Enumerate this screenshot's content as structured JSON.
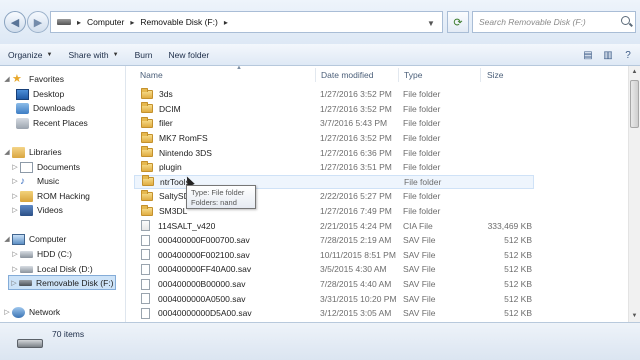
{
  "window": {
    "breadcrumb": [
      "Computer",
      "Removable Disk (F:)"
    ],
    "search_placeholder": "Search Removable Disk (F:)"
  },
  "toolbar": {
    "organize": "Organize",
    "share_with": "Share with",
    "burn": "Burn",
    "new_folder": "New folder"
  },
  "sidebar": {
    "favorites": "Favorites",
    "favorites_items": [
      "Desktop",
      "Downloads",
      "Recent Places"
    ],
    "libraries": "Libraries",
    "libraries_items": [
      "Documents",
      "Music",
      "ROM Hacking",
      "Videos"
    ],
    "computer": "Computer",
    "computer_items": [
      "HDD (C:)",
      "Local Disk (D:)",
      "Removable Disk (F:)"
    ],
    "network": "Network"
  },
  "columns": {
    "name": "Name",
    "date": "Date modified",
    "type": "Type",
    "size": "Size"
  },
  "files": [
    {
      "name": "3ds",
      "date": "1/27/2016 3:52 PM",
      "type": "File folder",
      "size": "",
      "kind": "folder"
    },
    {
      "name": "DCIM",
      "date": "1/27/2016 3:52 PM",
      "type": "File folder",
      "size": "",
      "kind": "folder"
    },
    {
      "name": "filer",
      "date": "3/7/2016 5:43 PM",
      "type": "File folder",
      "size": "",
      "kind": "folder"
    },
    {
      "name": "MK7 RomFS",
      "date": "1/27/2016 3:52 PM",
      "type": "File folder",
      "size": "",
      "kind": "folder"
    },
    {
      "name": "Nintendo 3DS",
      "date": "1/27/2016 6:36 PM",
      "type": "File folder",
      "size": "",
      "kind": "folder"
    },
    {
      "name": "plugin",
      "date": "1/27/2016 3:51 PM",
      "type": "File folder",
      "size": "",
      "kind": "folder"
    },
    {
      "name": "ntrTools",
      "date": "",
      "type": "File folder",
      "size": "",
      "kind": "folder"
    },
    {
      "name": "SaltySD",
      "date": "2/22/2016 5:27 PM",
      "type": "File folder",
      "size": "",
      "kind": "folder"
    },
    {
      "name": "SM3DL",
      "date": "1/27/2016 7:49 PM",
      "type": "File folder",
      "size": "",
      "kind": "folder"
    },
    {
      "name": "114SALT_v420",
      "date": "2/21/2015 4:24 PM",
      "type": "CIA File",
      "size": "333,469 KB",
      "kind": "cia"
    },
    {
      "name": "000400000F000700.sav",
      "date": "7/28/2015 2:19 AM",
      "type": "SAV File",
      "size": "512 KB",
      "kind": "file"
    },
    {
      "name": "000400000F002100.sav",
      "date": "10/11/2015 8:51 PM",
      "type": "SAV File",
      "size": "512 KB",
      "kind": "file"
    },
    {
      "name": "000400000FF40A00.sav",
      "date": "3/5/2015 4:30 AM",
      "type": "SAV File",
      "size": "512 KB",
      "kind": "file"
    },
    {
      "name": "000400000B00000.sav",
      "date": "7/28/2015 4:40 AM",
      "type": "SAV File",
      "size": "512 KB",
      "kind": "file"
    },
    {
      "name": "0004000000A0500.sav",
      "date": "3/31/2015 10:20 PM",
      "type": "SAV File",
      "size": "512 KB",
      "kind": "file"
    },
    {
      "name": "00040000000D5A00.sav",
      "date": "3/12/2015 3:05 AM",
      "type": "SAV File",
      "size": "512 KB",
      "kind": "file"
    }
  ],
  "tooltip": {
    "line1": "Type: File folder",
    "line2": "Folders: nand"
  },
  "status": {
    "item_count": "70 items"
  }
}
